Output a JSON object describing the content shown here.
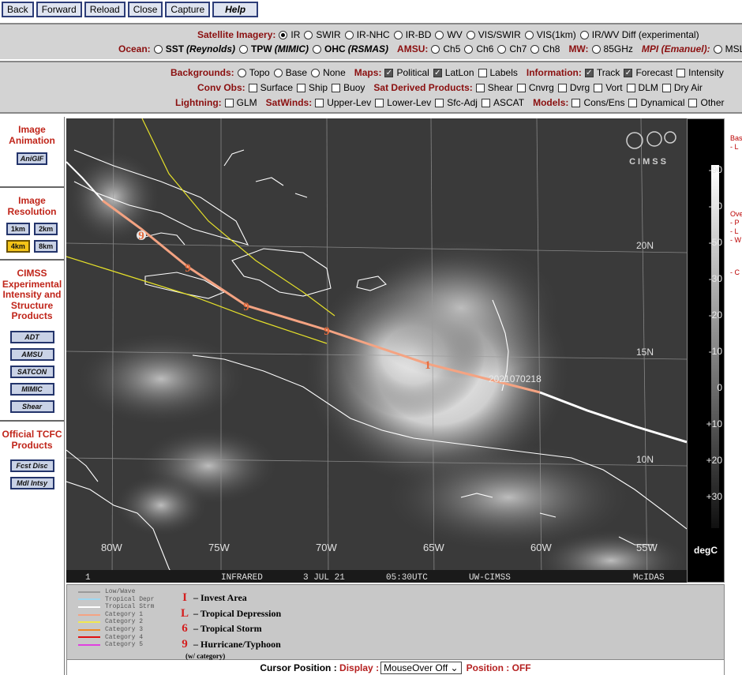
{
  "nav": {
    "back": "Back",
    "forward": "Forward",
    "reload": "Reload",
    "close": "Close",
    "capture": "Capture",
    "help": "Help"
  },
  "imagery": {
    "satellite_label": "Satellite Imagery:",
    "satellite_options": [
      {
        "label": "IR",
        "selected": true
      },
      {
        "label": "SWIR",
        "selected": false
      },
      {
        "label": "IR-NHC",
        "selected": false
      },
      {
        "label": "IR-BD",
        "selected": false
      },
      {
        "label": "WV",
        "selected": false
      },
      {
        "label": "VIS/SWIR",
        "selected": false
      },
      {
        "label": "VIS(1km)",
        "selected": false
      },
      {
        "label": "IR/WV Diff (experimental)",
        "selected": false
      }
    ],
    "ocean_label": "Ocean:",
    "sst": "SST",
    "sst_paren": "(Reynolds)",
    "tpw": "TPW",
    "tpw_paren": "(MIMIC)",
    "ohc": "OHC",
    "ohc_paren": "(RSMAS)",
    "amsu_label": "AMSU:",
    "amsu_options": [
      "Ch5",
      "Ch6",
      "Ch7",
      "Ch8"
    ],
    "mw_label": "MW:",
    "mw_option": "85GHz",
    "mpi_label": "MPI (Emanuel):",
    "mpi_option": "MSL"
  },
  "overlays": {
    "backgrounds_label": "Backgrounds:",
    "backgrounds": [
      {
        "label": "Topo",
        "selected": false
      },
      {
        "label": "Base",
        "selected": false
      },
      {
        "label": "None",
        "selected": false
      }
    ],
    "maps_label": "Maps:",
    "maps": [
      {
        "label": "Political",
        "checked": true
      },
      {
        "label": "LatLon",
        "checked": true
      },
      {
        "label": "Labels",
        "checked": false
      }
    ],
    "information_label": "Information:",
    "information": [
      {
        "label": "Track",
        "checked": true
      },
      {
        "label": "Forecast",
        "checked": true
      },
      {
        "label": "Intensity",
        "checked": false
      }
    ],
    "convobs_label": "Conv Obs:",
    "convobs": [
      {
        "label": "Surface",
        "checked": false
      },
      {
        "label": "Ship",
        "checked": false
      },
      {
        "label": "Buoy",
        "checked": false
      }
    ],
    "satderived_label": "Sat Derived Products:",
    "satderived": [
      {
        "label": "Shear",
        "checked": false
      },
      {
        "label": "Cnvrg",
        "checked": false
      },
      {
        "label": "Dvrg",
        "checked": false
      },
      {
        "label": "Vort",
        "checked": false
      },
      {
        "label": "DLM",
        "checked": false
      },
      {
        "label": "Dry Air",
        "checked": false
      }
    ],
    "lightning_label": "Lightning:",
    "lightning": [
      {
        "label": "GLM",
        "checked": false
      }
    ],
    "satwinds_label": "SatWinds:",
    "satwinds": [
      {
        "label": "Upper-Lev",
        "checked": false
      },
      {
        "label": "Lower-Lev",
        "checked": false
      },
      {
        "label": "Sfc-Adj",
        "checked": false
      },
      {
        "label": "ASCAT",
        "checked": false
      }
    ],
    "models_label": "Models:",
    "models": [
      {
        "label": "Cons/Ens",
        "checked": false
      },
      {
        "label": "Dynamical",
        "checked": false
      },
      {
        "label": "Other",
        "checked": false
      }
    ]
  },
  "sidebar": {
    "animation_title": "Image Animation",
    "animgif": "AniGIF",
    "resolution_title": "Image Resolution",
    "res_1km": "1km",
    "res_2km": "2km",
    "res_4km": "4km",
    "res_8km": "8km",
    "cimss_title": "CIMSS Experimental Intensity and Structure Products",
    "cimss_buttons": [
      "ADT",
      "AMSU",
      "SATCON",
      "MIMIC",
      "Shear"
    ],
    "tcfc_title": "Official TCFC Products",
    "tcfc_buttons": [
      "Fcst Disc",
      "Mdl Intsy"
    ]
  },
  "map": {
    "lat_labels": [
      "20N",
      "15N",
      "10N"
    ],
    "lon_labels": [
      "80W",
      "75W",
      "70W",
      "65W",
      "60W",
      "55W"
    ],
    "timestamp": "2021070218",
    "footer": {
      "frame": "1",
      "channel": "INFRARED",
      "date": "3 JUL 21",
      "time": "05:30UTC",
      "source": "UW-CIMSS",
      "software": "McIDAS"
    },
    "logo": "CIMSS",
    "track_colors": {
      "forecast": "#f4a382",
      "cone": "#e5e02a",
      "track": "#ffffff"
    }
  },
  "colorbar": {
    "ticks": [
      "-90",
      "-70",
      "-50",
      "-30",
      "-20",
      "-10",
      "0",
      "+10",
      "+20",
      "+30"
    ],
    "unit": "degC"
  },
  "right_strip": {
    "items": [
      "Bas",
      "- L",
      "Ove",
      "- P",
      "- L",
      "- W",
      "- C"
    ]
  },
  "legend": {
    "lines": [
      {
        "label": "Low/Wave",
        "color": "#9a9a9a"
      },
      {
        "label": "Tropical Depr",
        "color": "#9fd8f0"
      },
      {
        "label": "Tropical Strm",
        "color": "#ffffff"
      },
      {
        "label": "Category 1",
        "color": "#f4a382"
      },
      {
        "label": "Category 2",
        "color": "#f0e850"
      },
      {
        "label": "Category 3",
        "color": "#f08a24"
      },
      {
        "label": "Category 4",
        "color": "#e01010"
      },
      {
        "label": "Category 5",
        "color": "#e040e0"
      }
    ],
    "types": [
      {
        "symbol": "I",
        "label": "– Invest Area"
      },
      {
        "symbol": "L",
        "label": "– Tropical Depression"
      },
      {
        "symbol": "6",
        "label": "– Tropical Storm"
      },
      {
        "symbol": "9",
        "label": "– Hurricane/Typhoon"
      }
    ],
    "wcat_note": "(w/ category)"
  },
  "cursor": {
    "label": "Cursor Position :",
    "display_label": "Display :",
    "display_value": "MouseOver Off",
    "position_label": "Position :",
    "position_value": "OFF"
  }
}
